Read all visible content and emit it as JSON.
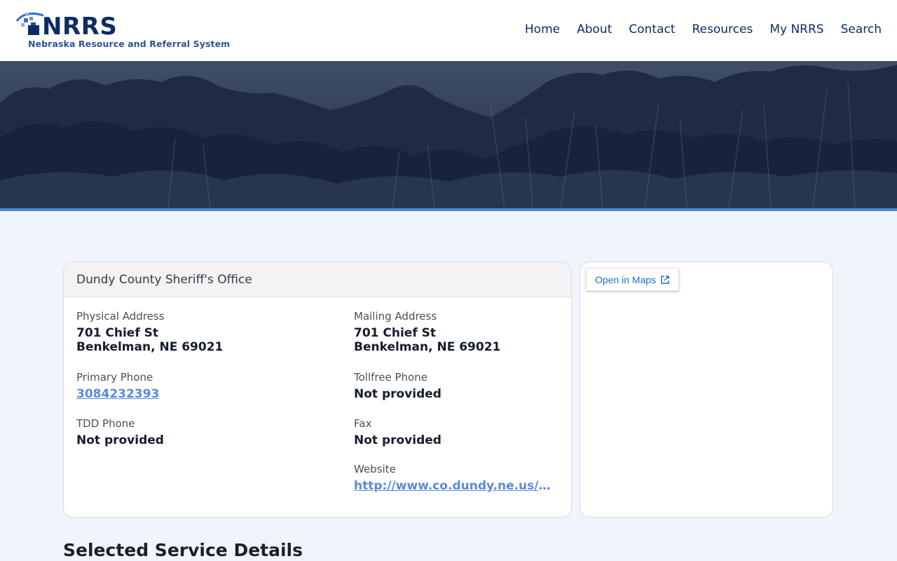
{
  "header": {
    "logo_text": "NRRS",
    "logo_subtitle": "Nebraska Resource and Referral System",
    "nav": [
      "Home",
      "About",
      "Contact",
      "Resources",
      "My NRRS",
      "Search"
    ]
  },
  "agency": {
    "name": "Dundy County Sheriff's Office",
    "physical_address": {
      "label": "Physical Address",
      "line1": "701 Chief St",
      "line2": "Benkelman, NE 69021"
    },
    "mailing_address": {
      "label": "Mailing Address",
      "line1": "701 Chief St",
      "line2": "Benkelman, NE 69021"
    },
    "primary_phone": {
      "label": "Primary Phone",
      "value": "3084232393"
    },
    "tollfree_phone": {
      "label": "Tollfree Phone",
      "value": "Not provided"
    },
    "tdd_phone": {
      "label": "TDD Phone",
      "value": "Not provided"
    },
    "fax": {
      "label": "Fax",
      "value": "Not provided"
    },
    "website": {
      "label": "Website",
      "value": "http://www.co.dundy.ne.us/sheriff"
    }
  },
  "map": {
    "open_label": "Open in Maps"
  },
  "section": {
    "title": "Selected Service Details"
  },
  "colors": {
    "brand_navy": "#0e2c63",
    "link_blue": "#5b8ad9",
    "accent_stripe": "#4f86d6",
    "page_bg": "#f0f5fc"
  },
  "icons": {
    "logo": "nrrs-logo-mark",
    "map_external": "external-link-icon"
  }
}
